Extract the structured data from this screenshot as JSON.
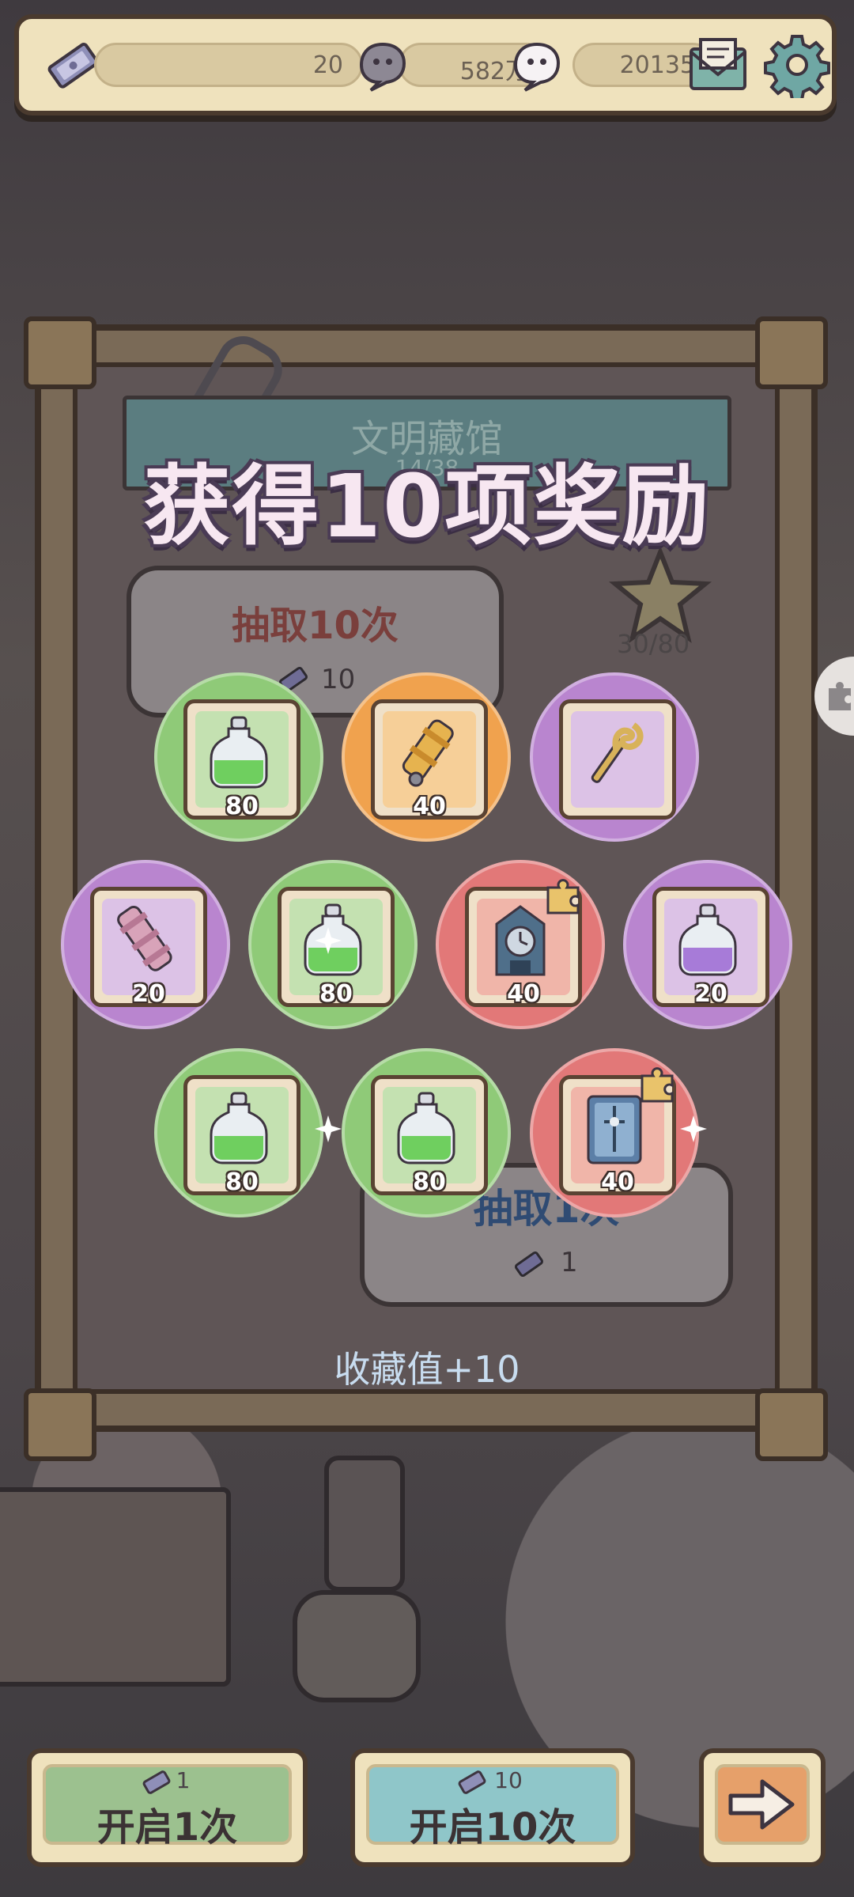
{
  "topbar": {
    "tickets": "20",
    "coins": "582万",
    "souls": "20135",
    "icons": [
      "ticket-icon",
      "grey-ghost-icon",
      "white-ghost-icon",
      "mail-icon",
      "gear-icon"
    ]
  },
  "background_sign": {
    "title": "文明藏馆",
    "subtitle": "14/38"
  },
  "draw_panel": {
    "title": "抽取10次",
    "cost": "10",
    "star_progress": "30/80",
    "single_title": "抽取1次",
    "single_cost": "1"
  },
  "modal": {
    "title": "获得10项奖励",
    "collection_text": "收藏值+10"
  },
  "rewards": [
    {
      "qty": "80",
      "rarity": "green",
      "item": "green-potion-icon"
    },
    {
      "qty": "40",
      "rarity": "orange",
      "item": "golden-cannon-icon"
    },
    {
      "qty": "",
      "rarity": "purple",
      "item": "golden-scepter-icon"
    },
    {
      "qty": "20",
      "rarity": "purple",
      "item": "pink-cannon-icon"
    },
    {
      "qty": "80",
      "rarity": "green",
      "item": "green-potion-icon"
    },
    {
      "qty": "40",
      "rarity": "red",
      "item": "clock-tower-icon"
    },
    {
      "qty": "20",
      "rarity": "purple",
      "item": "purple-potion-icon"
    },
    {
      "qty": "80",
      "rarity": "green",
      "item": "green-potion-icon"
    },
    {
      "qty": "80",
      "rarity": "green",
      "item": "green-potion-icon"
    },
    {
      "qty": "40",
      "rarity": "red",
      "item": "blue-card-icon"
    }
  ],
  "colors": {
    "green": "#8fca78",
    "orange": "#f0a24e",
    "purple": "#b985cf",
    "red": "#e27878"
  },
  "bottom": {
    "open1_cost": "1",
    "open1_label": "开启1次",
    "open10_cost": "10",
    "open10_label": "开启10次",
    "next_icon": "arrow-right-icon"
  }
}
